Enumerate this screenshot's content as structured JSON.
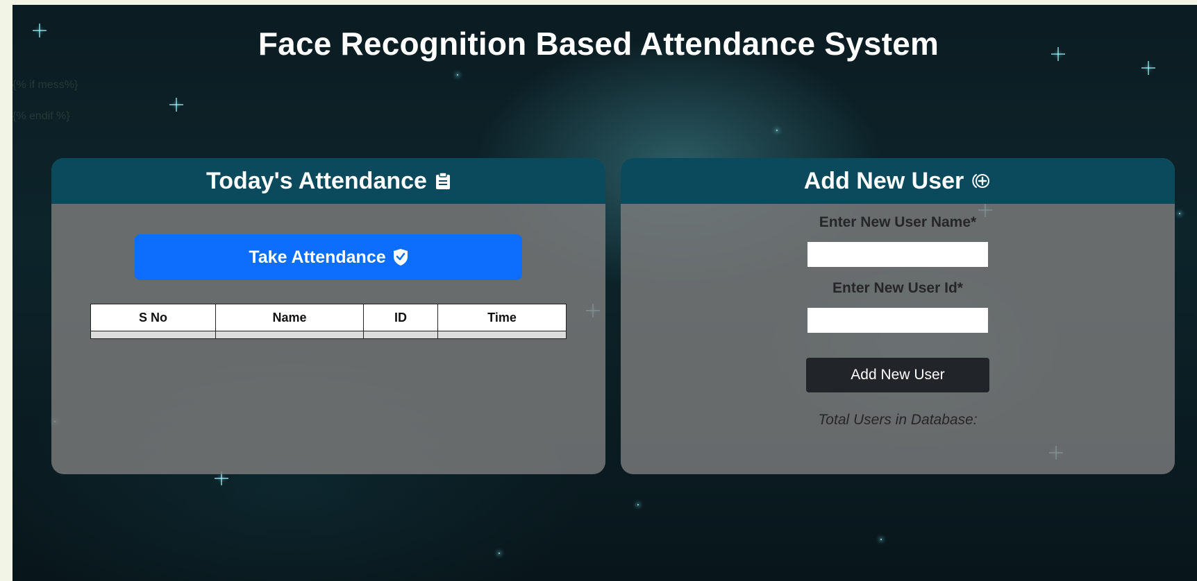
{
  "page": {
    "title": "Face Recognition Based Attendance System",
    "template_text": [
      "{% if mess%}",
      "{% endif %}"
    ]
  },
  "attendance": {
    "header": "Today's Attendance",
    "header_icon": "clipboard-icon",
    "take_button_label": "Take Attendance",
    "take_button_icon": "shield-check-icon",
    "columns": [
      "S No",
      "Name",
      "ID",
      "Time"
    ],
    "rows": []
  },
  "add_user": {
    "header": "Add New User",
    "header_icon": "plus-circle-icon",
    "name_label": "Enter New User Name*",
    "name_value": "",
    "id_label": "Enter New User Id*",
    "id_value": "",
    "button_label": "Add New User",
    "total_label": "Total Users in Database:"
  },
  "colors": {
    "header_bg": "#0b4a5c",
    "primary_button": "#0d6efd",
    "dark_button": "#212529"
  }
}
